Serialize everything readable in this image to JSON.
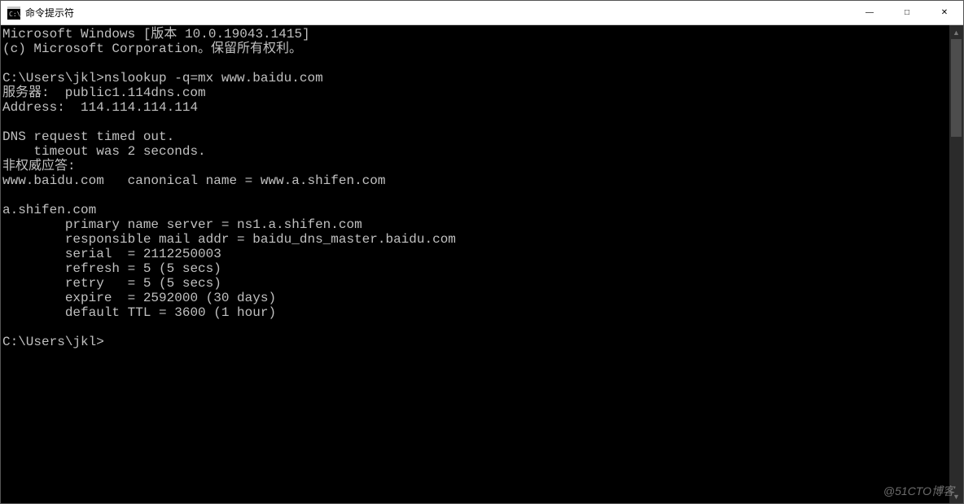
{
  "window": {
    "title": "命令提示符",
    "icon_name": "cmd-icon",
    "buttons": {
      "minimize": "—",
      "maximize": "□",
      "close": "✕"
    }
  },
  "terminal": {
    "lines": [
      "Microsoft Windows [版本 10.0.19043.1415]",
      "(c) Microsoft Corporation。保留所有权利。",
      "",
      "C:\\Users\\jkl>nslookup -q=mx www.baidu.com",
      "服务器:  public1.114dns.com",
      "Address:  114.114.114.114",
      "",
      "DNS request timed out.",
      "    timeout was 2 seconds.",
      "非权威应答:",
      "www.baidu.com   canonical name = www.a.shifen.com",
      "",
      "a.shifen.com",
      "        primary name server = ns1.a.shifen.com",
      "        responsible mail addr = baidu_dns_master.baidu.com",
      "        serial  = 2112250003",
      "        refresh = 5 (5 secs)",
      "        retry   = 5 (5 secs)",
      "        expire  = 2592000 (30 days)",
      "        default TTL = 3600 (1 hour)",
      "",
      "C:\\Users\\jkl>"
    ]
  },
  "watermark": "@51CTO博客"
}
